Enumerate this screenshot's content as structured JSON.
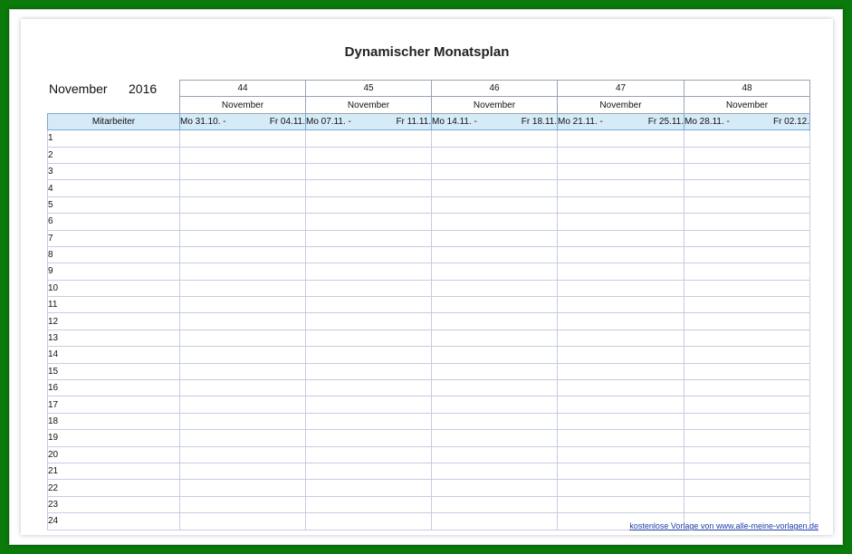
{
  "document": {
    "title": "Dynamischer Monatsplan",
    "month": "November",
    "year": "2016",
    "employee_header": "Mitarbeiter",
    "footer_link": "kostenlose Vorlage von www.alle-meine-vorlagen.de"
  },
  "weeks": [
    {
      "kw": "44",
      "month": "November",
      "from": "Mo 31.10. -",
      "to": "Fr 04.11."
    },
    {
      "kw": "45",
      "month": "November",
      "from": "Mo 07.11. -",
      "to": "Fr 11.11."
    },
    {
      "kw": "46",
      "month": "November",
      "from": "Mo 14.11. -",
      "to": "Fr 18.11."
    },
    {
      "kw": "47",
      "month": "November",
      "from": "Mo 21.11. -",
      "to": "Fr 25.11."
    },
    {
      "kw": "48",
      "month": "November",
      "from": "Mo 28.11. -",
      "to": "Fr 02.12."
    }
  ],
  "rows": [
    "1",
    "2",
    "3",
    "4",
    "5",
    "6",
    "7",
    "8",
    "9",
    "10",
    "11",
    "12",
    "13",
    "14",
    "15",
    "16",
    "17",
    "18",
    "19",
    "20",
    "21",
    "22",
    "23",
    "24"
  ],
  "separator_rows": [
    "12",
    "15"
  ],
  "colors": {
    "background": "#0a7a0a",
    "header_fill": "#d6ebf8",
    "link": "#1a3ea8"
  }
}
